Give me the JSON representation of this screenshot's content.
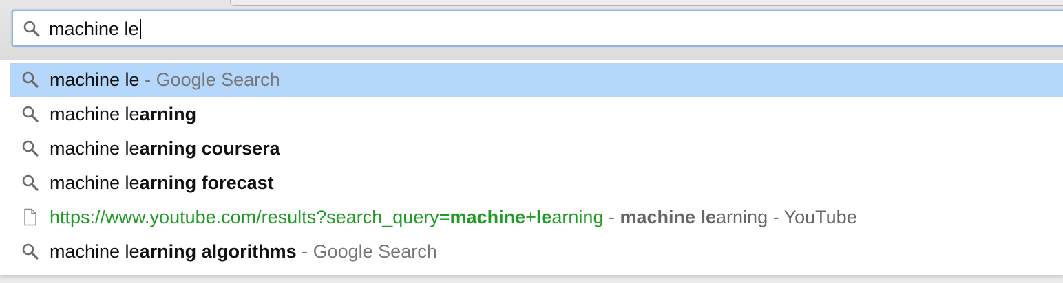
{
  "omnibox": {
    "query": "machine le",
    "icon": "search-icon"
  },
  "suggestions": [
    {
      "icon": "search-icon",
      "query": "machine le",
      "separator": " - ",
      "source": "Google Search",
      "selected": true
    },
    {
      "icon": "search-icon",
      "typed": "machine le",
      "completion": "arning"
    },
    {
      "icon": "search-icon",
      "typed": "machine le",
      "completion": "arning coursera"
    },
    {
      "icon": "search-icon",
      "typed": "machine le",
      "completion": "arning forecast"
    },
    {
      "icon": "page-icon",
      "url_prefix": "https://www.youtube.com/results?search_query=",
      "url_match1": "machine",
      "url_plus": "+",
      "url_match2": "le",
      "url_rest": "arning",
      "separator1": " - ",
      "title_match": "machine le",
      "title_rest": "arning",
      "separator2": " - ",
      "site": "YouTube"
    },
    {
      "icon": "search-icon",
      "typed": "machine le",
      "completion": "arning algorithms",
      "separator": " - ",
      "source": "Google Search"
    }
  ],
  "colors": {
    "selected_row": "#b4d7fb",
    "url_green": "#1f9b26",
    "secondary_gray": "#777777",
    "focus_border": "#8fb4dd"
  }
}
